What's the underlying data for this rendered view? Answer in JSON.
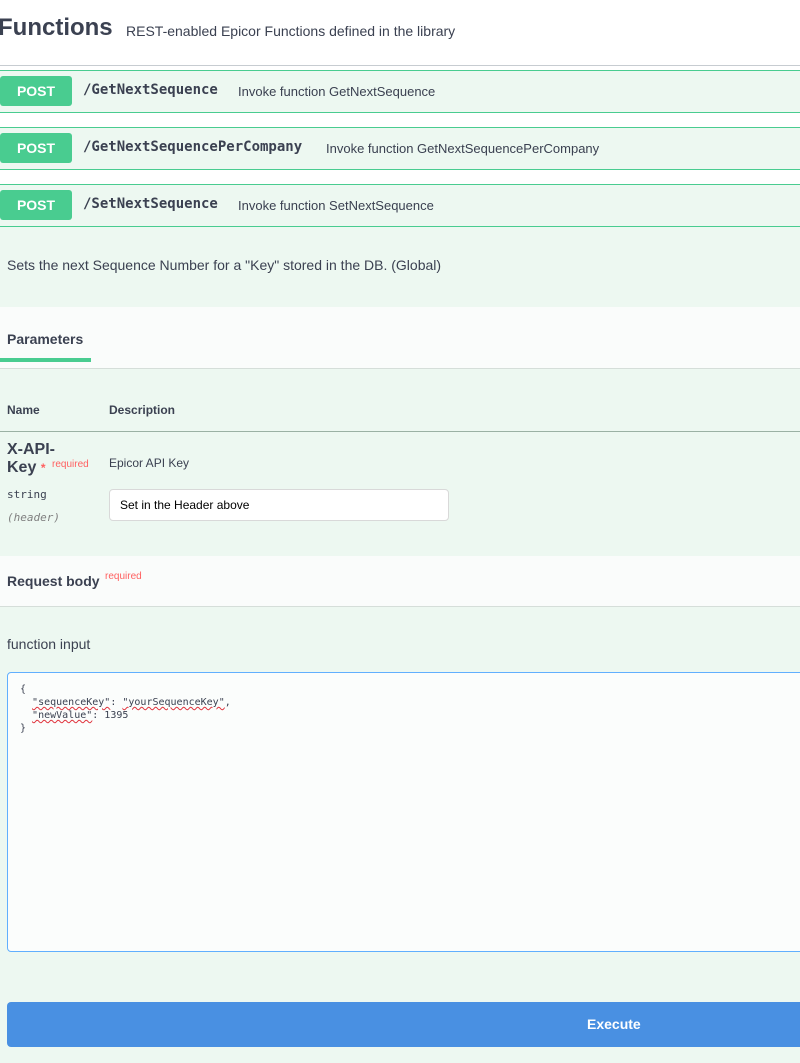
{
  "header": {
    "title": "Functions",
    "description": "REST-enabled Epicor Functions defined in the library"
  },
  "operations": [
    {
      "method": "POST",
      "path": "/GetNextSequence",
      "summary": "Invoke function GetNextSequence"
    },
    {
      "method": "POST",
      "path": "/GetNextSequencePerCompany",
      "summary": "Invoke function GetNextSequencePerCompany"
    },
    {
      "method": "POST",
      "path": "/SetNextSequence",
      "summary": "Invoke function SetNextSequence"
    }
  ],
  "expanded": {
    "description": "Sets the next Sequence Number for a \"Key\" stored in the DB. (Global)",
    "parameters_tab": "Parameters",
    "columns": {
      "name": "Name",
      "description": "Description"
    },
    "parameter": {
      "name": "X-API-Key",
      "required_star": "*",
      "required_label": "required",
      "type": "string",
      "location": "(header)",
      "description": "Epicor API Key",
      "value": "Set in the Header above"
    },
    "request_body": {
      "title": "Request body",
      "required_label": "required",
      "input_label": "function input",
      "code": {
        "line1": "{",
        "line2_indent": "  ",
        "line2_key": "\"sequenceKey\"",
        "line2_sep": ": ",
        "line2_val": "\"yourSequenceKey\"",
        "line2_end": ",",
        "line3_indent": "  ",
        "line3_key": "\"newValue\"",
        "line3_rest": ": 1395",
        "line4": "}"
      }
    },
    "execute_label": "Execute"
  }
}
